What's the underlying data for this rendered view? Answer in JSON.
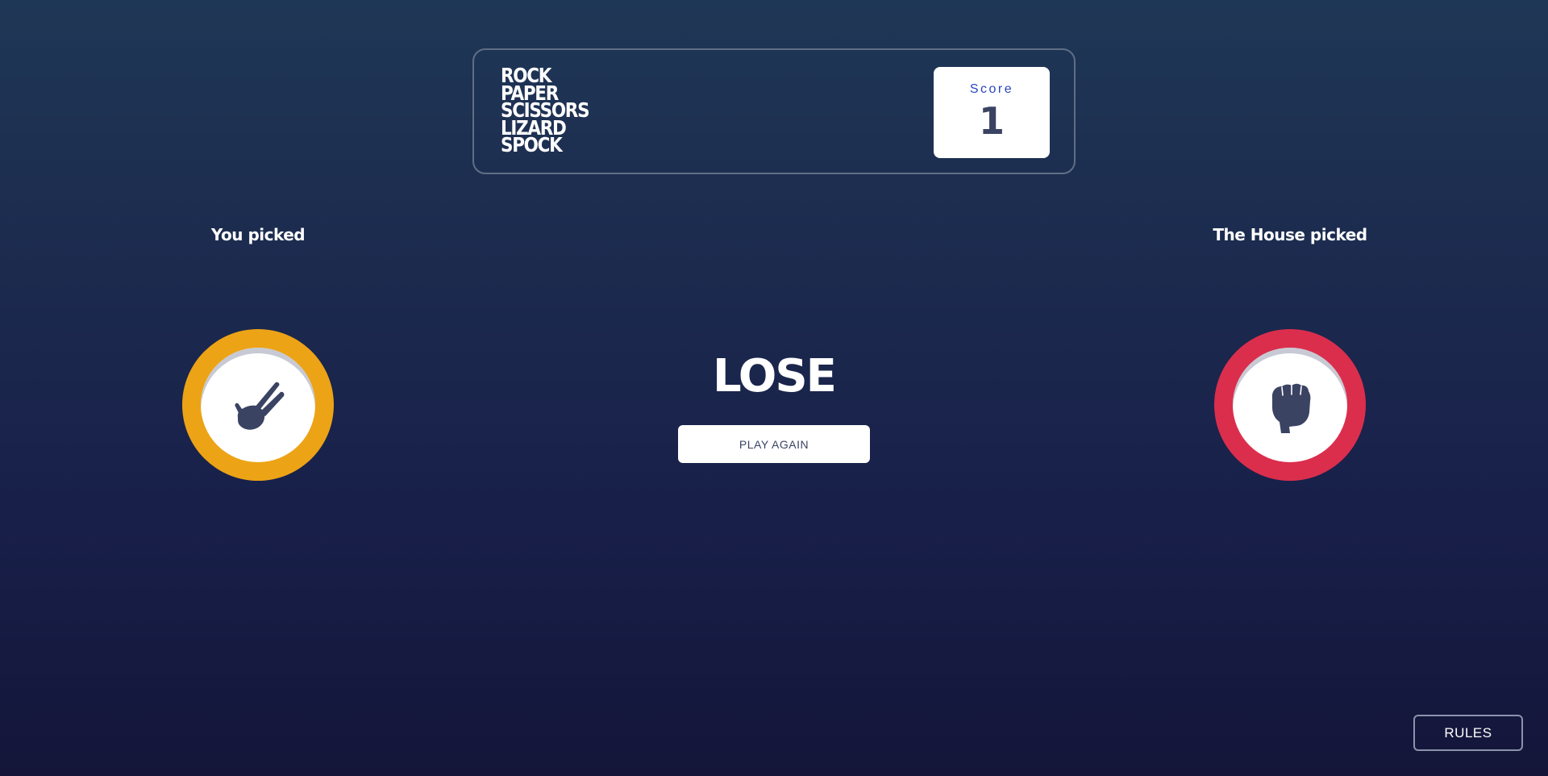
{
  "header": {
    "title_lines": [
      "ROCK",
      "PAPER",
      "SCISSORS",
      "LIZARD",
      "SPOCK"
    ],
    "score_label": "Score",
    "score_value": "1"
  },
  "player": {
    "label": "You picked",
    "choice_icon": "scissors-icon",
    "ring_color": "#eca316"
  },
  "house": {
    "label": "The House picked",
    "choice_icon": "rock-icon",
    "ring_color": "#db2e4d"
  },
  "result": {
    "text": "LOSE",
    "play_again_label": "PLAY AGAIN"
  },
  "footer": {
    "rules_label": "RULES"
  },
  "colors": {
    "background_top": "#1f3756",
    "background_bottom": "#141539",
    "header_border": "#606e85",
    "score_label": "#2a46c0",
    "dark_text": "#3b4363"
  }
}
